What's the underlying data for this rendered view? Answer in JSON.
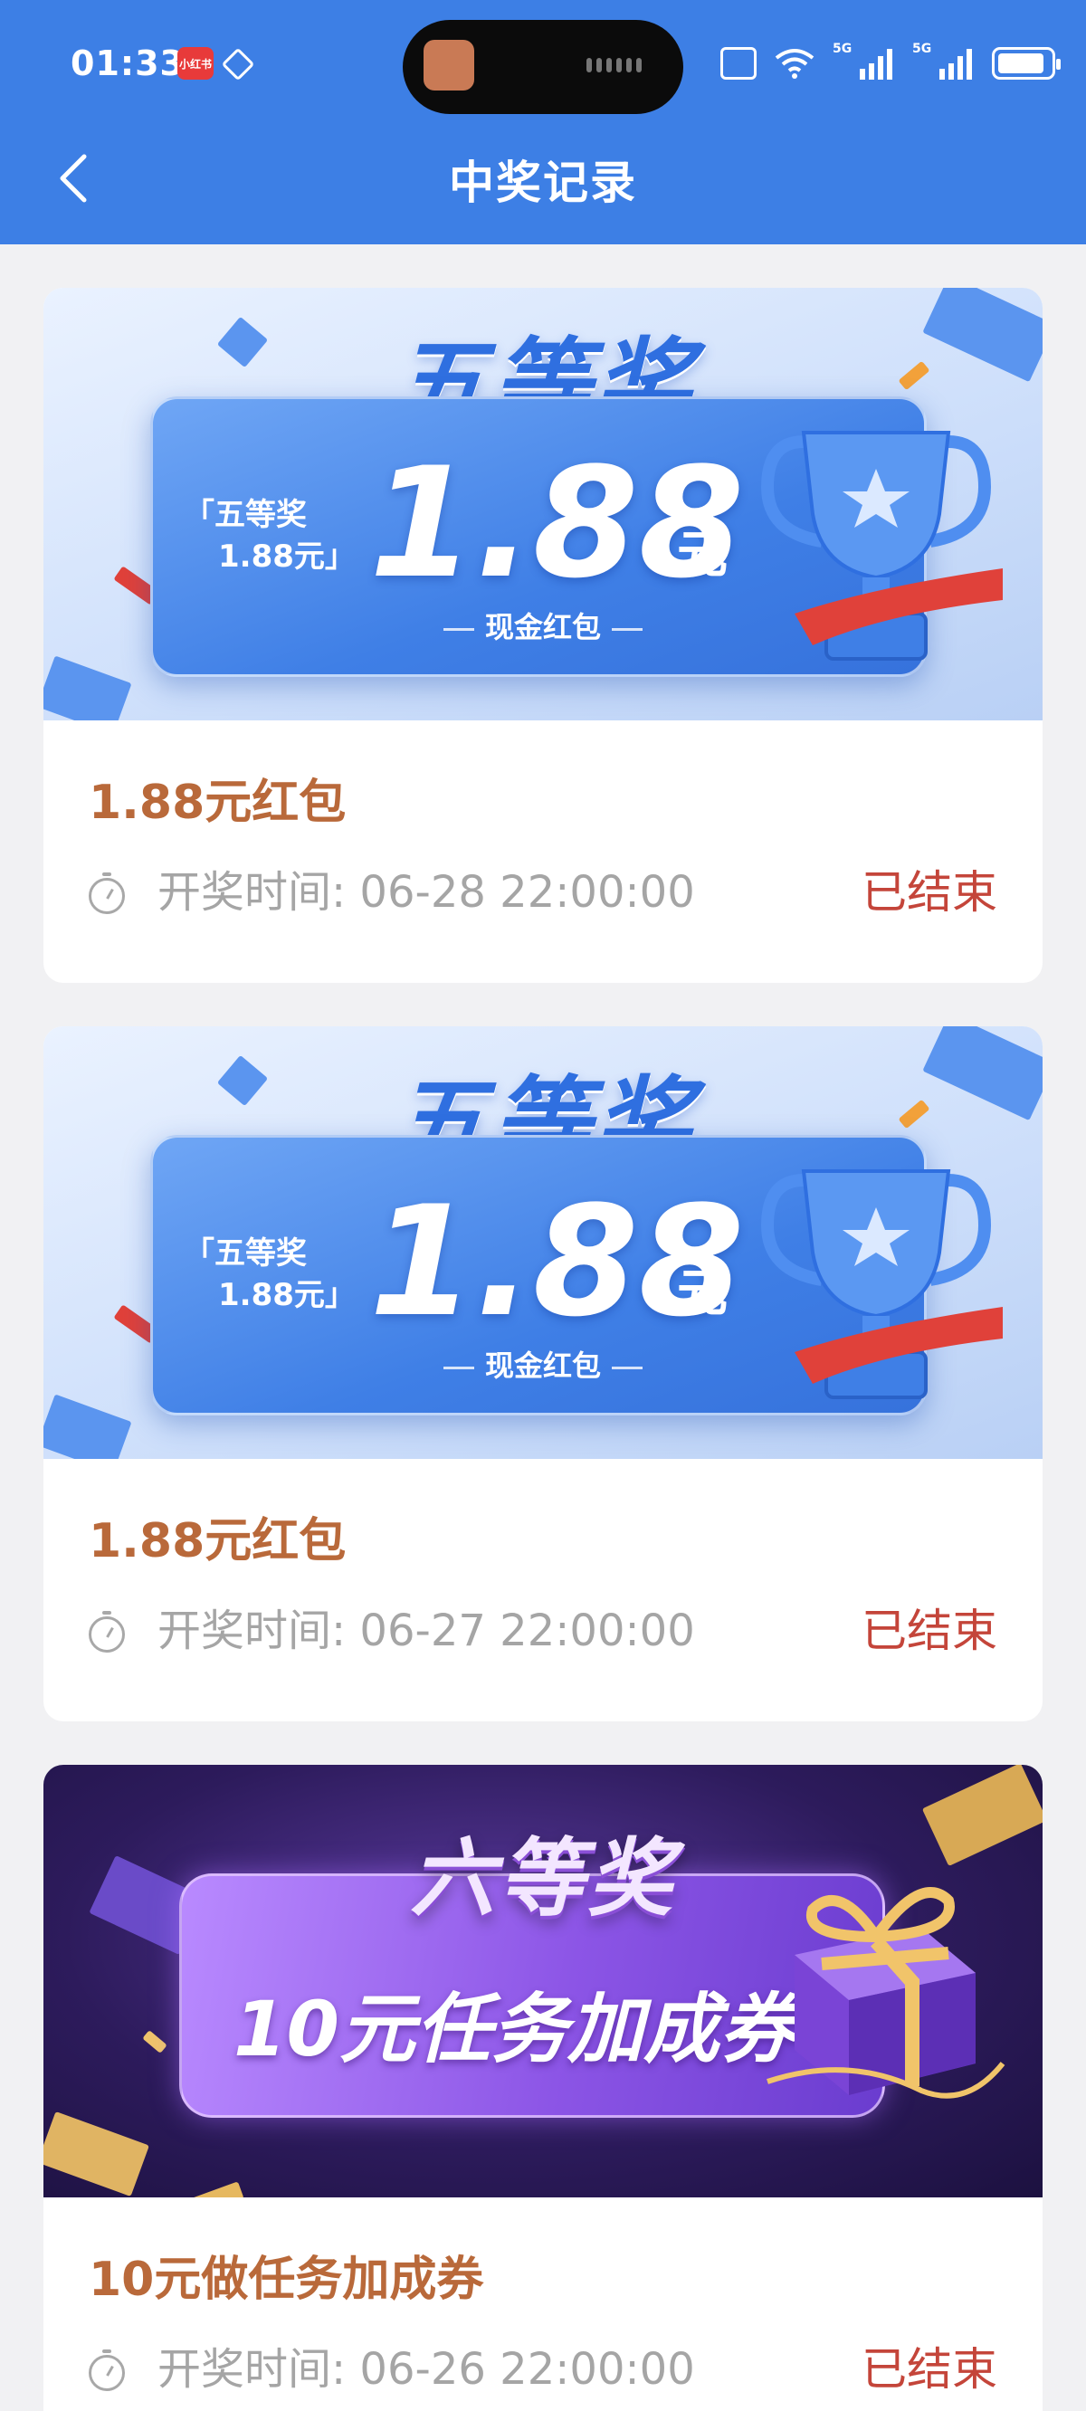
{
  "status_bar": {
    "time": "01:33",
    "badge_text": "小红书",
    "signal_1": "5G",
    "signal_2": "5G"
  },
  "header": {
    "title": "中奖记录",
    "back_icon": "chevron-left-icon",
    "background_color": "#3d7fe5"
  },
  "records": [
    {
      "banner": {
        "theme": "blue",
        "grade": "五等奖",
        "tag_line1": "「五等奖",
        "tag_line2": "1.88元」",
        "amount": "1.88",
        "unit": "元",
        "caption": "现金红包"
      },
      "prize_name": "1.88元红包",
      "draw_time": "开奖时间: 06-28 22:00:00",
      "status": "已结束"
    },
    {
      "banner": {
        "theme": "blue",
        "grade": "五等奖",
        "tag_line1": "「五等奖",
        "tag_line2": "1.88元」",
        "amount": "1.88",
        "unit": "元",
        "caption": "现金红包"
      },
      "prize_name": "1.88元红包",
      "draw_time": "开奖时间: 06-27 22:00:00",
      "status": "已结束"
    },
    {
      "banner": {
        "theme": "purple",
        "grade": "六等奖",
        "headline": "10元任务加成券"
      },
      "prize_name": "10元做任务加成券",
      "draw_time": "开奖时间: 06-26 22:00:00",
      "status": "已结束"
    }
  ],
  "colors": {
    "prize_name": "#b9693a",
    "status_ended": "#c4453a",
    "draw_time": "#a5a5a5",
    "page_background": "#f1f1f3"
  }
}
